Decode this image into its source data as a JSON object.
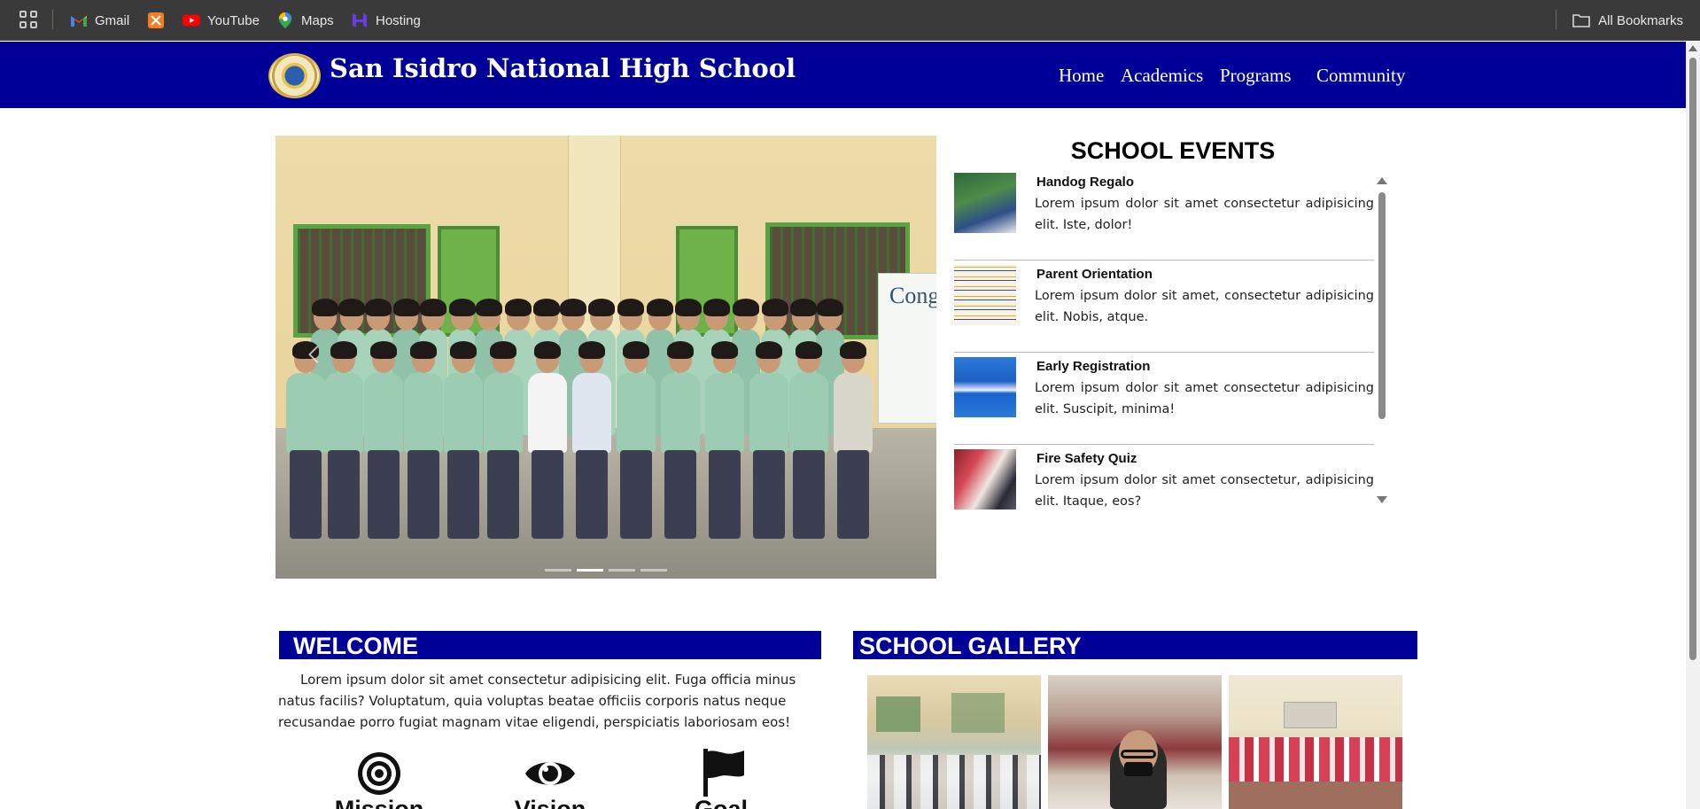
{
  "bookmarks": {
    "items": [
      {
        "label": "Gmail",
        "icon": "gmail-icon"
      },
      {
        "label": "",
        "icon": "xampp-icon"
      },
      {
        "label": "YouTube",
        "icon": "youtube-icon"
      },
      {
        "label": "Maps",
        "icon": "maps-icon"
      },
      {
        "label": "Hosting",
        "icon": "hosting-icon"
      }
    ],
    "all_bookmarks": "All Bookmarks"
  },
  "header": {
    "title": "San Isidro National High School",
    "nav": [
      "Home",
      "Academics",
      "Programs",
      "Community"
    ]
  },
  "carousel": {
    "banner_text": "Cong",
    "slide_count": 4,
    "active_slide": 2
  },
  "events": {
    "title": "SCHOOL EVENTS",
    "items": [
      {
        "title": "Handog Regalo",
        "desc": "Lorem ipsum dolor sit amet consectetur adipisicing elit. Iste, dolor!"
      },
      {
        "title": "Parent Orientation",
        "desc": "Lorem ipsum dolor sit amet, consectetur adipisicing elit. Nobis, atque."
      },
      {
        "title": "Early Registration",
        "desc": "Lorem ipsum dolor sit amet consectetur adipisicing elit. Suscipit, minima!"
      },
      {
        "title": "Fire Safety Quiz",
        "desc": "Lorem ipsum dolor sit amet consectetur, adipisicing elit. Itaque, eos?"
      }
    ]
  },
  "welcome": {
    "title": "WELCOME",
    "text": "Lorem ipsum dolor sit amet consectetur adipisicing elit. Fuga officia minus natus facilis? Voluptatum, quia voluptas beatae officiis corporis natus neque recusandae porro fugiat magnam vitae eligendi, perspiciatis laboriosam eos!",
    "pillars": [
      {
        "label": "Mission",
        "icon": "target-icon"
      },
      {
        "label": "Vision",
        "icon": "eye-icon"
      },
      {
        "label": "Goal",
        "icon": "flag-icon"
      }
    ]
  },
  "gallery": {
    "title": "SCHOOL GALLERY"
  },
  "colors": {
    "brand_navy": "#000099",
    "bookmarks_bar": "#3a3a3a"
  }
}
